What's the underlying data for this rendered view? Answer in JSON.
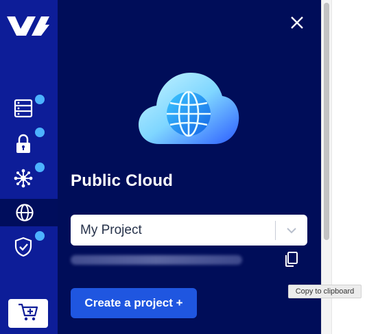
{
  "colors": {
    "rail_bg": "#0d1d98",
    "panel_bg": "#000d59",
    "active_item_bg": "#000d5c",
    "notification_dot": "#4cb2ff",
    "primary_button": "#1f56e0"
  },
  "rail": {
    "items": [
      {
        "icon": "server-icon",
        "has_dot": true
      },
      {
        "icon": "lock-icon",
        "has_dot": true
      },
      {
        "icon": "network-icon",
        "has_dot": true
      },
      {
        "icon": "globe-icon",
        "has_dot": false,
        "active": true
      },
      {
        "icon": "shield-check-icon",
        "has_dot": true
      }
    ],
    "cart_icon": "cart-add-icon"
  },
  "panel": {
    "title": "Public Cloud",
    "close_icon": "close-icon",
    "hero_icon": "cloud-globe-icon",
    "project_select": {
      "value": "My Project"
    },
    "copy_icon": "copy-icon",
    "create_button_label": "Create a project +"
  },
  "tooltip": {
    "text": "Copy to clipboard"
  }
}
